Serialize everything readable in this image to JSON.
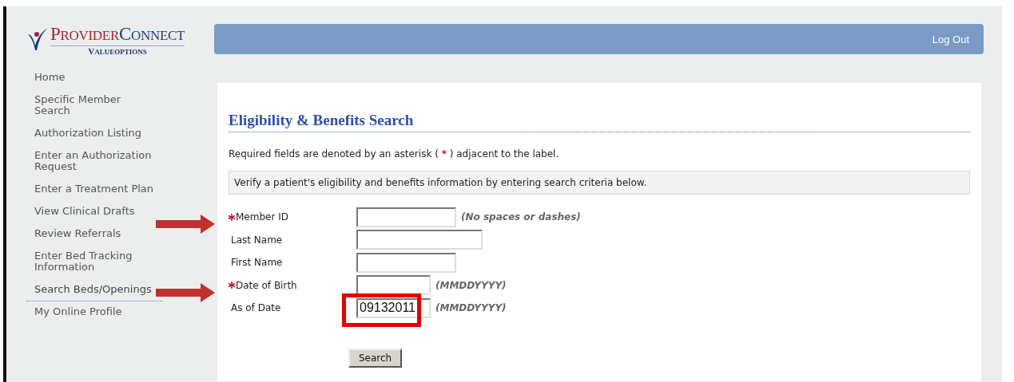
{
  "logo": {
    "brand_first": "PROVIDER",
    "brand_second": "CONNECT",
    "sub": "VALUEOPTIONS"
  },
  "header": {
    "logout": "Log Out"
  },
  "sidebar": {
    "items": [
      {
        "label": "Home",
        "selected": false
      },
      {
        "label": "Specific Member Search",
        "selected": false
      },
      {
        "label": "Authorization Listing",
        "selected": false
      },
      {
        "label": "Enter an Authorization Request",
        "selected": false
      },
      {
        "label": "Enter a Treatment Plan",
        "selected": false
      },
      {
        "label": "View Clinical Drafts",
        "selected": false
      },
      {
        "label": "Review Referrals",
        "selected": false
      },
      {
        "label": "Enter Bed Tracking Information",
        "selected": false
      },
      {
        "label": "Search Beds/Openings",
        "selected": true
      },
      {
        "label": "My Online Profile",
        "selected": false
      }
    ]
  },
  "content": {
    "title": "Eligibility & Benefits Search",
    "required_note": {
      "before": "Required fields are denoted by an asterisk ( ",
      "mark": "*",
      "after": " ) adjacent to the label."
    },
    "info": "Verify a patient's eligibility and benefits information by entering search criteria below.",
    "fields": [
      {
        "label": "Member ID",
        "required": true,
        "hint": "(No spaces or dashes)"
      },
      {
        "label": "Last Name",
        "required": false
      },
      {
        "label": "First Name",
        "required": false
      },
      {
        "label": "Date of Birth",
        "required": true,
        "hint": "(MMDDYYYY)"
      },
      {
        "label": "As of Date",
        "required": false,
        "value": "09132011",
        "hint": "(MMDDYYYY)"
      }
    ],
    "search_button": "Search"
  }
}
